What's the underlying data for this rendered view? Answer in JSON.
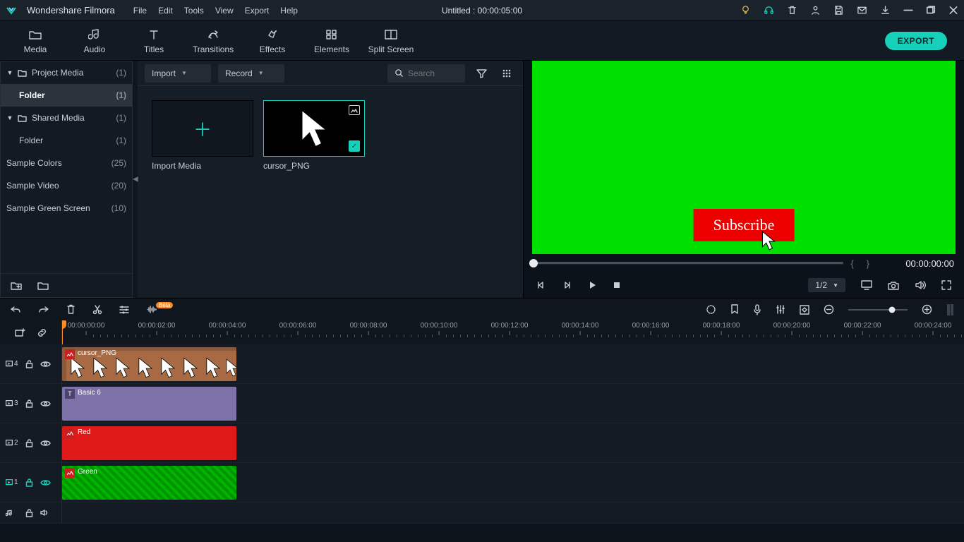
{
  "app": {
    "name": "Wondershare Filmora",
    "title": "Untitled : 00:00:05:00"
  },
  "menu": [
    "File",
    "Edit",
    "Tools",
    "View",
    "Export",
    "Help"
  ],
  "tabs": [
    {
      "id": "media",
      "label": "Media"
    },
    {
      "id": "audio",
      "label": "Audio"
    },
    {
      "id": "titles",
      "label": "Titles"
    },
    {
      "id": "transitions",
      "label": "Transitions"
    },
    {
      "id": "effects",
      "label": "Effects"
    },
    {
      "id": "elements",
      "label": "Elements"
    },
    {
      "id": "splitscreen",
      "label": "Split Screen"
    }
  ],
  "export_label": "EXPORT",
  "sidebar": {
    "nodes": [
      {
        "label": "Project Media",
        "count": "(1)",
        "chevron": true,
        "folder": true,
        "level": 0
      },
      {
        "label": "Folder",
        "count": "(1)",
        "chevron": false,
        "folder": false,
        "level": 1,
        "active": true,
        "bold": true
      },
      {
        "label": "Shared Media",
        "count": "(1)",
        "chevron": true,
        "folder": true,
        "level": 0
      },
      {
        "label": "Folder",
        "count": "(1)",
        "chevron": false,
        "folder": false,
        "level": 1
      },
      {
        "label": "Sample Colors",
        "count": "(25)",
        "chevron": false,
        "folder": false,
        "level": 0
      },
      {
        "label": "Sample Video",
        "count": "(20)",
        "chevron": false,
        "folder": false,
        "level": 0
      },
      {
        "label": "Sample Green Screen",
        "count": "(10)",
        "chevron": false,
        "folder": false,
        "level": 0
      }
    ]
  },
  "mediabar": {
    "import": "Import",
    "record": "Record",
    "search_placeholder": "Search"
  },
  "thumbs": {
    "import_media": "Import Media",
    "cursor": "cursor_PNG"
  },
  "preview": {
    "subscribe": "Subscribe",
    "timecode": "00:00:00:00",
    "ratio": "1/2"
  },
  "ruler": {
    "marks": [
      "00:00:00:00",
      "00:00:02:00",
      "00:00:04:00",
      "00:00:06:00",
      "00:00:08:00",
      "00:00:10:00",
      "00:00:12:00",
      "00:00:14:00",
      "00:00:16:00",
      "00:00:18:00",
      "00:00:20:00",
      "00:00:22:00",
      "00:00:24:00"
    ]
  },
  "tracks": [
    {
      "id": "4",
      "clip": "cursor_PNG",
      "type": "cursor"
    },
    {
      "id": "3",
      "clip": "Basic 6",
      "type": "basic"
    },
    {
      "id": "2",
      "clip": "Red",
      "type": "red"
    },
    {
      "id": "1",
      "clip": "Green",
      "type": "green",
      "locked": true
    }
  ],
  "beta": "Beta"
}
